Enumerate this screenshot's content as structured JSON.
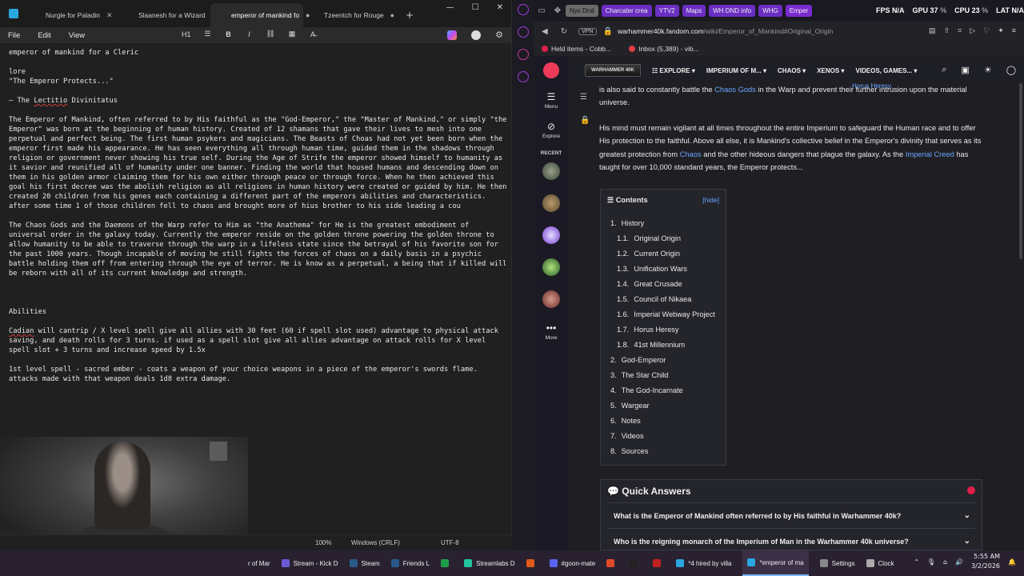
{
  "notepad": {
    "tabs": [
      {
        "label": "Nurgle for Paladin",
        "close": "✕"
      },
      {
        "label": "Slaanesh for a Wizard",
        "close": "✕"
      },
      {
        "label": "emperor of mankind fo",
        "close": "●"
      },
      {
        "label": "Tzeentch for Rouge",
        "close": "●"
      }
    ],
    "new_tab": "+",
    "menu": {
      "file": "File",
      "edit": "Edit",
      "view": "View"
    },
    "toolbar": {
      "heading": "H1",
      "list": "☰",
      "bold": "B",
      "italic": "I",
      "link": "🔗",
      "table": "▦",
      "clear": "A̶"
    },
    "status": {
      "zoom": "100%",
      "line_ending": "Windows (CRLF)",
      "encoding": "UTF-8"
    },
    "content": {
      "title": "emperor of mankind for a Cleric",
      "lore": "lore",
      "quote": "\"The Emperor Protects...\"",
      "lectitio_prefix": "— The ",
      "lectitio_underlined": "Lectitio",
      "lectitio_suffix": " Divinitatus",
      "para1": "The Emperor of Mankind, often referred to by His faithful as the \"God-Emperor,\" the \"Master of Mankind,\" or simply \"the Emperor\" was born at the beginning of human history. Created of 12 shamans that gave their lives to mesh into one perpetual and perfect being. The first human psykers and magicians. The Beasts of Choas had not yet been born when the emperor first made his appearance. He has seen everything all through human time, guided them in the shadows through religion or government never showing his true self. During the Age of Strife the emperor showed himself to humanity as it savior and reunified all of humanity under one banner. Finding the world that housed humans and descending down on them in his golden armor claiming them for his own either through peace or through force. When he then achieved this goal his first decree was the abolish religion as all religions in human history were created or guided by him. He then created 20 children from his genes each containing a different part of the emperors abilities and characteristics. after some time 1 of those children fell to chaos and brought more of hius brother to his side leading a cou",
      "para2": "The Chaos Gods and the Daemons of the Warp refer to Him as \"the Anathema\" for He is the greatest embodiment of universal order in the galaxy today. Currently the emperor reside on the golden throne powering the golden throne to allow humanity to be able to traverse through the warp in a lifeless state since the betrayal of his favorite son for the past 1000 years. Though incapable of moving he still fights the forces of chaos on a daily basis in a psychic battle holding them off from entering through the eye of terror. He is know as a perpetual, a being that if killed will be reborn with all of its current knowledge and strength.",
      "abilities": "Abilities",
      "ability1_prefix": "Cadian",
      "ability1": " will cantrip / X level spell give all allies with 30 feet (60 if spell slot used) advantage to physical attack saving, and death rolls for 3 turns. if used as a spell slot give all allies advantage on attack rolls for X level spell slot + 3 turns and increase speed by 1.5x",
      "ability2": "1st level spell - sacred ember - coats a weapon of your choice weapons in a piece of the emperor's swords flame. attacks made with that weapon deals 1d8 extra damage."
    }
  },
  "browser": {
    "tabs": [
      "Nyx Dnd",
      "Charcater crea",
      "YTV2",
      "Maps",
      "WH DND info",
      "WHG",
      "Emper"
    ],
    "stats": {
      "fps_label": "FPS",
      "fps": "N/A",
      "gpu_label": "GPU",
      "gpu": "37",
      "cpu_label": "CPU",
      "cpu": "23",
      "lat_label": "LAT",
      "lat": "N/A",
      "pct": "%"
    },
    "vpn": "VPN",
    "url_host": "warhammer40k.fandom.com",
    "url_path": "/wiki/Emperor_of_Mankind#Original_Origin",
    "bookmarks": [
      "Held items - Cobb...",
      "Inbox (5,389) - vib..."
    ],
    "rail": {
      "menu": "Menu",
      "explore": "Explore",
      "recent": "RECENT",
      "more": "More"
    },
    "site_nav": [
      "EXPLORE",
      "IMPERIUM OF M...",
      "CHAOS",
      "XENOS",
      "VIDEOS, GAMES..."
    ],
    "logo_text": "WARHAMMER 40K",
    "horus_note": "Horus Heresy.",
    "article": {
      "p1_a": "is also said to constantly battle the ",
      "p1_link": "Chaos Gods",
      "p1_b": " in the Warp and prevent their further intrusion upon the material universe.",
      "p2_a": "His mind must remain vigilant at all times throughout the entire Imperium to safeguard the Human race and to offer His protection to the faithful. Above all else, it is Mankind's collective belief in the Emperor's divinity that serves as its greatest protection from ",
      "p2_link1": "Chaos",
      "p2_b": " and the other hideous dangers that plague the galaxy. As the ",
      "p2_link2": "Imperial Creed",
      "p2_c": " has taught for over 10,000 standard years, the Emperor protects..."
    },
    "toc": {
      "title": "Contents",
      "hide": "[hide]",
      "items": [
        {
          "num": "1.",
          "label": "History",
          "sub": false
        },
        {
          "num": "1.1.",
          "label": "Original Origin",
          "sub": true
        },
        {
          "num": "1.2.",
          "label": "Current Origin",
          "sub": true
        },
        {
          "num": "1.3.",
          "label": "Unification Wars",
          "sub": true
        },
        {
          "num": "1.4.",
          "label": "Great Crusade",
          "sub": true
        },
        {
          "num": "1.5.",
          "label": "Council of Nikaea",
          "sub": true
        },
        {
          "num": "1.6.",
          "label": "Imperial Webway Project",
          "sub": true
        },
        {
          "num": "1.7.",
          "label": "Horus Heresy",
          "sub": true
        },
        {
          "num": "1.8.",
          "label": "41st Millennium",
          "sub": true
        },
        {
          "num": "2.",
          "label": "God-Emperor",
          "sub": false
        },
        {
          "num": "3.",
          "label": "The Star Child",
          "sub": false
        },
        {
          "num": "4.",
          "label": "The God-Incarnate",
          "sub": false
        },
        {
          "num": "5.",
          "label": "Wargear",
          "sub": false
        },
        {
          "num": "6.",
          "label": "Notes",
          "sub": false
        },
        {
          "num": "7.",
          "label": "Videos",
          "sub": false
        },
        {
          "num": "8.",
          "label": "Sources",
          "sub": false
        }
      ]
    },
    "quick_answers": {
      "title": "Quick Answers",
      "q1": "What is the Emperor of Mankind often referred to by His faithful in Warhammer 40k?",
      "q2": "Who is the reigning monarch of the Imperium of Man in the Warhammer 40k universe?"
    }
  },
  "taskbar": {
    "items": [
      "r of Mar",
      "Stream - Kick D",
      "Steam",
      "Friends L",
      "Streamlabs D",
      "#goon-mate",
      "*4 hired by villa",
      "*emperor of ma",
      "Settings",
      "Clock"
    ],
    "time": "5:55 AM",
    "date": "3/2/2026"
  },
  "colors": {
    "link": "#6aa5ff",
    "accent_purple": "#6a2fc2",
    "fandom_red": "#f03a5a",
    "spell_underline": "#d04040"
  }
}
